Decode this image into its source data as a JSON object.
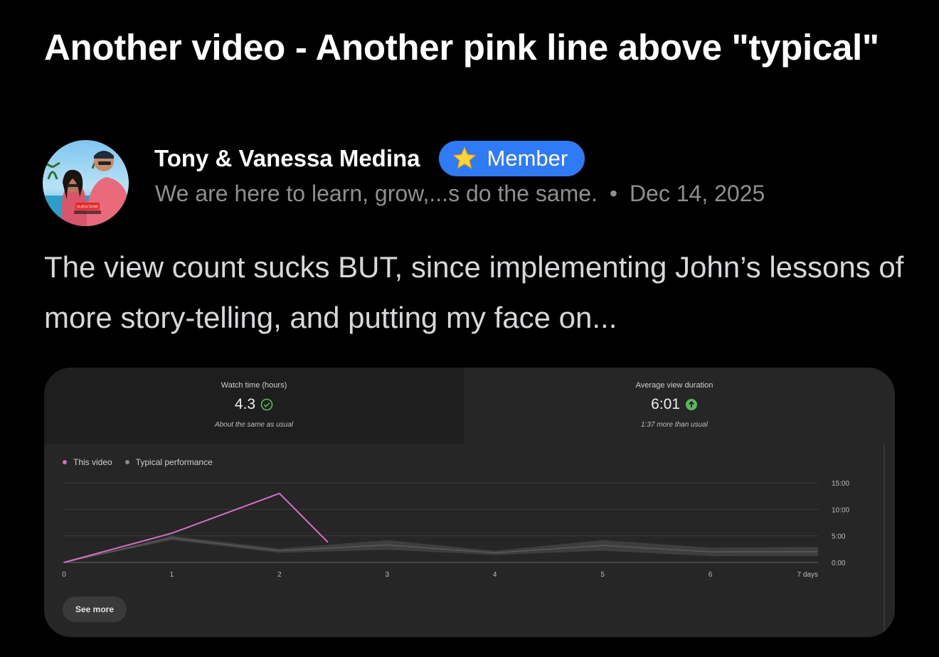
{
  "post": {
    "title": "Another video - Another pink line above \"typical\"",
    "author": "Tony & Vanessa Medina",
    "badge_label": "Member",
    "tagline": "We are here to learn, grow,...s do the same.",
    "separator": "•",
    "date": "Dec 14, 2025",
    "body": "The view count sucks BUT, since implementing John’s lessons of more story-telling, and putting my face on..."
  },
  "avatar": {
    "overlay_text": "SUBSCRIBE"
  },
  "icons": {
    "badge": "star-icon",
    "watch_status": "check-circle-icon",
    "duration_status": "arrow-up-circle-icon"
  },
  "colors": {
    "badge_bg": "#2f7bf5",
    "this_video": "#d46fc3",
    "typical": "#8a8a8a",
    "status_green": "#5cb85c"
  },
  "analytics": {
    "watch_time": {
      "label": "Watch time (hours)",
      "value": "4.3",
      "note": "About the same as usual"
    },
    "avg_duration": {
      "label": "Average view duration",
      "value": "6:01",
      "note": "1:37 more than usual"
    },
    "see_more": "See more"
  },
  "chart_data": {
    "type": "line",
    "legend": [
      "This video",
      "Typical performance"
    ],
    "x_tick_labels": [
      "0",
      "1",
      "2",
      "3",
      "4",
      "5",
      "6",
      "7 days"
    ],
    "y_tick_labels": [
      "15:00",
      "10:00",
      "5:00",
      "0:00"
    ],
    "ylim_minutes": [
      0,
      15
    ],
    "series": [
      {
        "name": "This video",
        "x": [
          0,
          1,
          2,
          2.45
        ],
        "y": [
          0,
          5.5,
          13,
          3.8
        ]
      }
    ],
    "typical_band": {
      "x": [
        0,
        1,
        2,
        3,
        4,
        5,
        6,
        7
      ],
      "low": [
        0,
        4.2,
        1.8,
        2.4,
        1.4,
        2.2,
        1.2,
        1.2
      ],
      "high": [
        0,
        5.0,
        2.6,
        4.2,
        2.2,
        4.2,
        2.8,
        2.9
      ]
    }
  }
}
